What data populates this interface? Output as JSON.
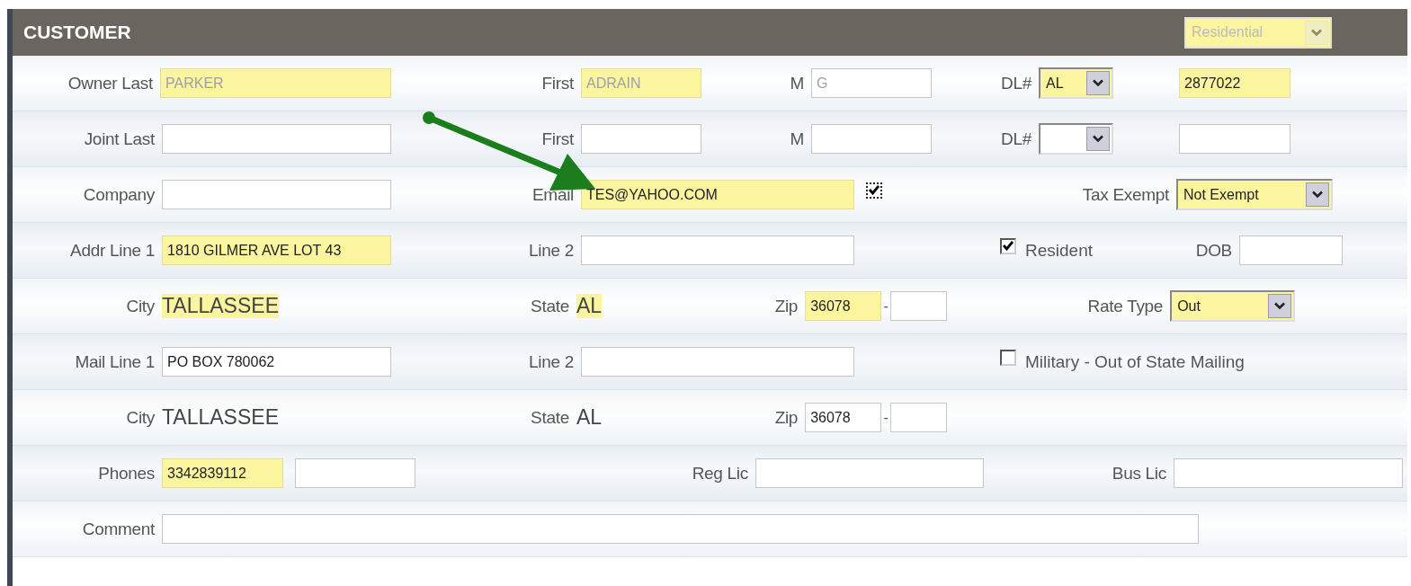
{
  "header": {
    "title": "CUSTOMER",
    "type_select": {
      "value": "Residential",
      "highlighted": true,
      "disabled": true
    }
  },
  "rows": [
    [
      {
        "kind": "input",
        "label": "Owner Last",
        "inputs": [
          {
            "value": "PARKER",
            "highlighted": true,
            "readonly": true
          }
        ]
      },
      {
        "kind": "input",
        "label": "First",
        "inputs": [
          {
            "value": "ADRAIN",
            "highlighted": true,
            "readonly": true
          }
        ]
      },
      {
        "kind": "input",
        "label": "M",
        "inputs": [
          {
            "value": "G",
            "highlighted": false,
            "readonly": true
          }
        ]
      },
      {
        "kind": "select",
        "label": "DL#",
        "value": "AL",
        "highlighted": true
      },
      {
        "kind": "input",
        "inputs": [
          {
            "value": "2877022",
            "highlighted": true,
            "readonly": false
          }
        ]
      }
    ],
    [
      {
        "kind": "input",
        "label": "Joint Last",
        "inputs": [
          {
            "highlighted": false
          }
        ]
      },
      {
        "kind": "input",
        "label": "First",
        "inputs": [
          {
            "highlighted": false
          }
        ]
      },
      {
        "kind": "input",
        "label": "M",
        "inputs": [
          {
            "highlighted": false
          }
        ]
      },
      {
        "kind": "select",
        "label": "DL#",
        "highlighted": false
      },
      {
        "kind": "input",
        "inputs": [
          {
            "highlighted": false
          }
        ]
      }
    ],
    [
      {
        "kind": "input",
        "label": "Company",
        "inputs": [
          {
            "highlighted": false
          }
        ]
      },
      {
        "kind": "input",
        "label": "Email",
        "inputs": [
          {
            "value": "TES@YAHOO.COM",
            "highlighted": true,
            "readonly": false
          }
        ]
      },
      {
        "kind": "check",
        "checked": true,
        "focused": true
      },
      {
        "kind": "select",
        "label": "Tax Exempt",
        "value": "Not Exempt",
        "highlighted": true
      }
    ],
    [
      {
        "kind": "input",
        "label": "Addr Line 1",
        "inputs": [
          {
            "value": "1810 GILMER AVE LOT 43",
            "highlighted": true,
            "readonly": false
          }
        ]
      },
      {
        "kind": "input",
        "label": "Line 2",
        "inputs": [
          {
            "highlighted": false
          }
        ]
      },
      {
        "kind": "check",
        "label": "Resident",
        "checked": true
      },
      {
        "kind": "input",
        "label": "DOB",
        "inputs": [
          {
            "highlighted": false
          }
        ]
      }
    ],
    [
      {
        "kind": "static",
        "label": "City",
        "value": "TALLASSEE",
        "highlighted": true
      },
      {
        "kind": "static",
        "label": "State",
        "value": "AL",
        "highlighted": true
      },
      {
        "kind": "input",
        "label": "Zip",
        "separator": "-",
        "inputs": [
          {
            "value": "36078",
            "highlighted": true,
            "readonly": false
          },
          {
            "highlighted": false
          }
        ]
      },
      {
        "kind": "select",
        "label": "Rate Type",
        "value": "Out",
        "highlighted": true
      }
    ],
    [
      {
        "kind": "input",
        "label": "Mail Line 1",
        "inputs": [
          {
            "value": "PO BOX 780062",
            "highlighted": false,
            "readonly": false
          }
        ]
      },
      {
        "kind": "input",
        "label": "Line 2",
        "inputs": [
          {
            "highlighted": false
          }
        ]
      },
      {
        "kind": "check",
        "label": "Military - Out of State Mailing",
        "checked": false
      }
    ],
    [
      {
        "kind": "static",
        "label": "City",
        "value": "TALLASSEE",
        "highlighted": false
      },
      {
        "kind": "static",
        "label": "State",
        "value": "AL",
        "highlighted": false
      },
      {
        "kind": "input",
        "label": "Zip",
        "separator": "-",
        "inputs": [
          {
            "value": "36078",
            "highlighted": false,
            "readonly": false
          },
          {
            "highlighted": false
          }
        ]
      }
    ],
    [
      {
        "kind": "input",
        "label": "Phones",
        "inputs": [
          {
            "value": "3342839112",
            "highlighted": true,
            "readonly": false
          },
          {
            "highlighted": false
          }
        ]
      },
      {
        "kind": "input",
        "label": "Reg Lic",
        "inputs": [
          {
            "highlighted": false
          }
        ]
      },
      {
        "kind": "input",
        "label": "Bus Lic",
        "inputs": [
          {
            "highlighted": false
          }
        ]
      }
    ],
    [
      {
        "kind": "input",
        "label": "Comment",
        "inputs": [
          {
            "highlighted": false
          }
        ]
      }
    ]
  ]
}
